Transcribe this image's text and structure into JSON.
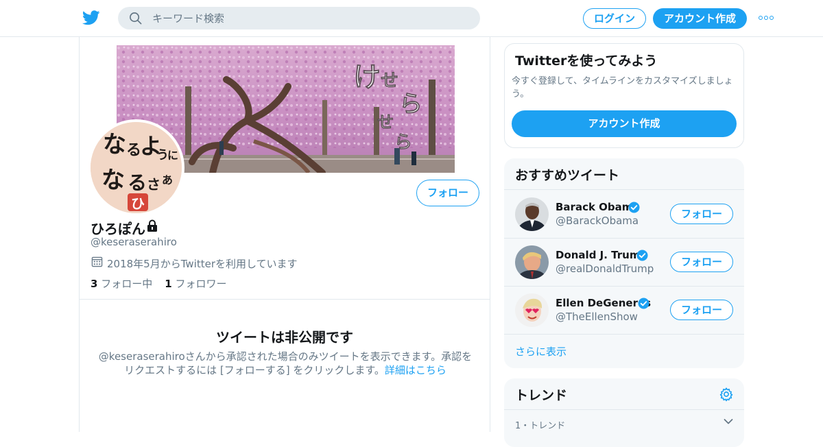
{
  "colors": {
    "accent": "#1da1f2",
    "text_primary": "#14171a",
    "text_secondary": "#657786",
    "border": "#e1e8ed",
    "panel_bg": "#f5f8fa"
  },
  "header": {
    "logo_icon": "twitter-bird-icon",
    "search_placeholder": "キーワード検索",
    "login_label": "ログイン",
    "signup_label": "アカウント作成",
    "more_icon": "more-dots-icon"
  },
  "profile": {
    "banner_text": [
      "け",
      "せ",
      "ら",
      "せ",
      "ら"
    ],
    "avatar_text": [
      "な",
      "る",
      "よ",
      "う",
      "に",
      "な",
      "る",
      "さ",
      "あ"
    ],
    "avatar_stamp": "ひ",
    "follow_label": "フォロー",
    "name": "ひろぽん",
    "lock_icon": "lock-icon",
    "handle": "@keseraserahiro",
    "calendar_icon": "calendar-icon",
    "joined": "2018年5月からTwitterを利用しています",
    "following_count": "3",
    "following_label": "フォロー中",
    "followers_count": "1",
    "followers_label": "フォロワー"
  },
  "private_notice": {
    "title": "ツイートは非公開です",
    "body": "@keseraserahiroさんから承認された場合のみツイートを表示できます。承認をリクエストするには [フォローする] をクリックします。",
    "link": "詳細はこちら"
  },
  "signup_card": {
    "title": "Twitterを使ってみよう",
    "body": "今すぐ登録して、タイムラインをカスタマイズしましょう。",
    "button": "アカウント作成"
  },
  "recommended": {
    "title": "おすすめツイート",
    "people": [
      {
        "name": "Barack Obama",
        "handle": "@BarackObama",
        "follow": "フォロー"
      },
      {
        "name": "Donald J. Trump",
        "handle": "@realDonaldTrump",
        "follow": "フォロー"
      },
      {
        "name": "Ellen DeGeneres",
        "handle": "@TheEllenShow",
        "follow": "フォロー"
      }
    ],
    "show_more": "さらに表示"
  },
  "trends": {
    "title": "トレンド",
    "settings_icon": "gear-icon",
    "first_meta": "1・トレンド",
    "expand_icon": "chevron-down-icon"
  }
}
